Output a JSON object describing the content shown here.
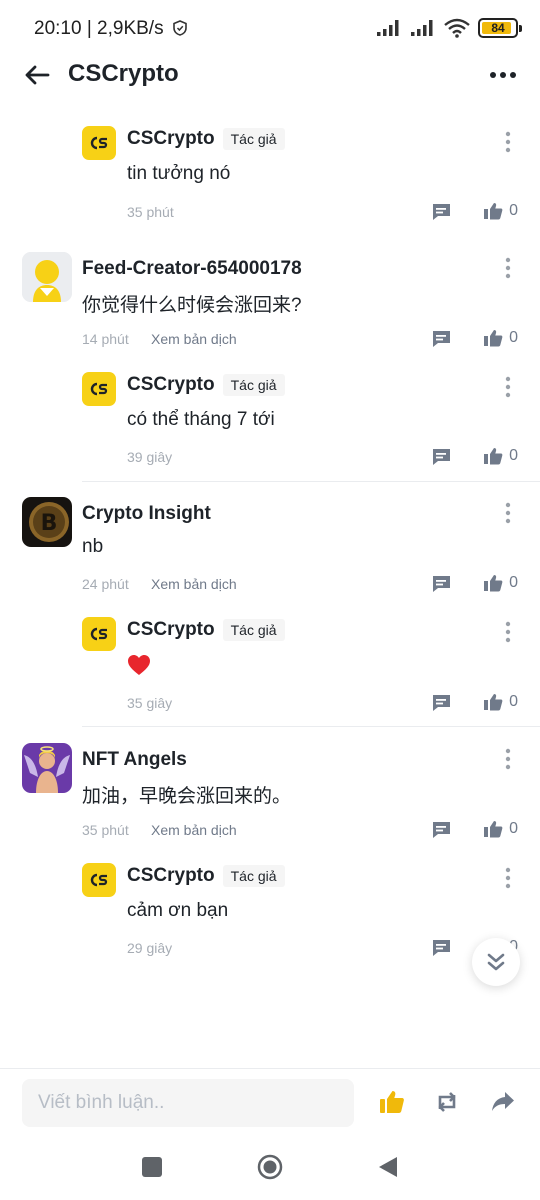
{
  "status_bar": {
    "time_text": "20:10 | 2,9KB/s",
    "battery_level": "84",
    "battery_fraction": 0.84
  },
  "header": {
    "title": "CSCrypto"
  },
  "colors": {
    "accent_yellow": "#f0b90b",
    "logo_yellow": "#f7d116",
    "text_primary": "#1e2329",
    "text_secondary": "#707a8a",
    "text_muted": "#a6acb4",
    "heart_red": "#e8262d"
  },
  "comments": [
    {
      "author": "CSCrypto",
      "tag": "Tác giả",
      "text": "tin tưởng nó",
      "time": "35 phút",
      "likes": "0",
      "avatar_icon": "cscrypto-logo-icon"
    },
    {
      "author": "Feed-Creator-654000178",
      "text": "你觉得什么时候会涨回来?",
      "time": "14 phút",
      "translate": "Xem bản dịch",
      "likes": "0",
      "avatar_icon": "default-user-avatar-icon"
    },
    {
      "author": "CSCrypto",
      "tag": "Tác giả",
      "text": "có thể tháng 7 tới",
      "time": "39 giây",
      "likes": "0",
      "avatar_icon": "cscrypto-logo-icon"
    },
    {
      "author": "Crypto Insight",
      "text": "nb",
      "time": "24 phút",
      "translate": "Xem bản dịch",
      "likes": "0",
      "avatar_icon": "bitcoin-coin-avatar-icon"
    },
    {
      "author": "CSCrypto",
      "tag": "Tác giả",
      "text_icon": "red-heart-icon",
      "time": "35 giây",
      "likes": "0",
      "avatar_icon": "cscrypto-logo-icon"
    },
    {
      "author": "NFT Angels",
      "text": "加油，早晚会涨回来的。",
      "time": "35 phút",
      "translate": "Xem bản dịch",
      "likes": "0",
      "avatar_icon": "angel-character-avatar-icon"
    },
    {
      "author": "CSCrypto",
      "tag": "Tác giả",
      "text": "cảm ơn bạn",
      "time": "29 giây",
      "likes": "0",
      "avatar_icon": "cscrypto-logo-icon"
    }
  ],
  "bottom_bar": {
    "input_placeholder": "Viết bình luận..",
    "icons": [
      "thumbs-up-icon",
      "repost-icon",
      "share-icon"
    ]
  },
  "nav_bar": {
    "icons": [
      "recents-square-icon",
      "home-circle-icon",
      "back-triangle-icon"
    ]
  }
}
